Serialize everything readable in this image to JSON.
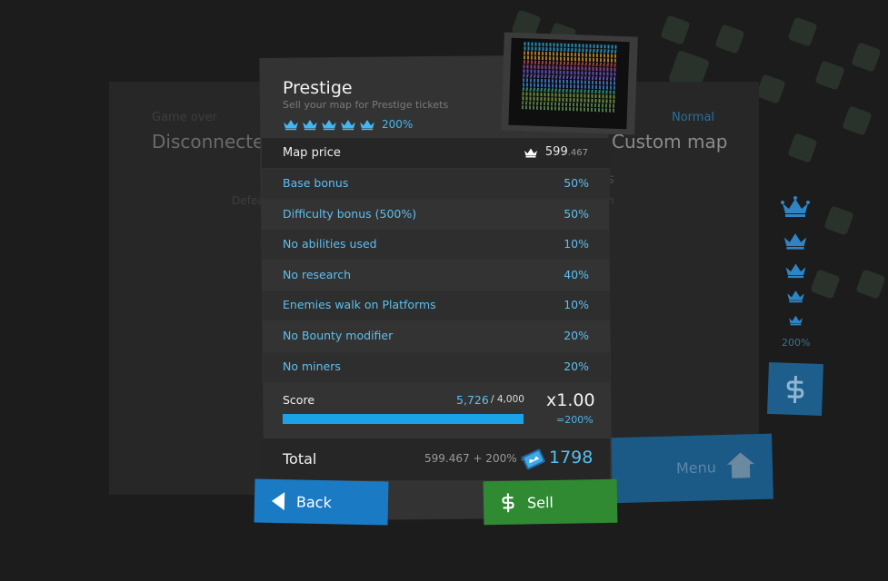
{
  "background": {
    "left_small": "Game over",
    "left_title": "Disconnected",
    "left_sub": "Defea",
    "right_small": "Normal",
    "right_title": "Custom map",
    "right_mid": "s",
    "right_mid2": "n",
    "side_crowns_pct": "200%",
    "menu_label": "Menu"
  },
  "dialog": {
    "title": "Prestige",
    "subtitle": "Sell your map for Prestige tickets",
    "crowns_count": 5,
    "crowns_pct": "200%",
    "map_price_label": "Map price",
    "map_price_int": "599",
    "map_price_dec": ".467",
    "bonuses": [
      {
        "label": "Base bonus",
        "value": "50%"
      },
      {
        "label": "Difficulty bonus (500%)",
        "value": "50%"
      },
      {
        "label": "No abilities used",
        "value": "10%"
      },
      {
        "label": "No research",
        "value": "40%"
      },
      {
        "label": "Enemies walk on Platforms",
        "value": "10%"
      },
      {
        "label": "No Bounty modifier",
        "value": "20%"
      },
      {
        "label": "No miners",
        "value": "20%"
      }
    ],
    "score_label": "Score",
    "score_value": "5,726",
    "score_max": "/ 4,000",
    "score_fill_fraction": 1.0,
    "multiplier": "x1.00",
    "multiplier_pct": "=200%",
    "total_label": "Total",
    "total_expression": "599.467 + 200% =",
    "total_value": "1798"
  },
  "buttons": {
    "back": "Back",
    "sell": "Sell"
  },
  "colors": {
    "accent_blue": "#44b7f0",
    "back_button": "#1a7bc4",
    "sell_button": "#2f8a32"
  }
}
